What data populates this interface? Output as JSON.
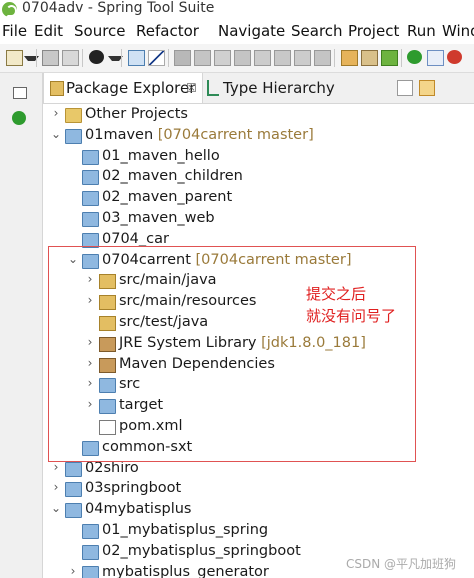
{
  "window": {
    "title": "0704adv - Spring Tool Suite"
  },
  "menu": [
    "File",
    "Edit",
    "Source",
    "Refactor",
    "Navigate",
    "Search",
    "Project",
    "Run",
    "Wind"
  ],
  "tabs": {
    "package_explorer": "Package Explorer",
    "close_glyph": "☒",
    "type_hierarchy": "Type Hierarchy"
  },
  "tree": [
    {
      "label": "Other Projects",
      "branch": "",
      "twisty": "›",
      "icon": "workingset",
      "indent": 0
    },
    {
      "label": "01maven",
      "branch": " [0704carrent master]",
      "twisty": "⌄",
      "icon": "project",
      "indent": 0
    },
    {
      "label": "01_maven_hello",
      "branch": "",
      "twisty": "",
      "icon": "folder",
      "indent": 1
    },
    {
      "label": "02_maven_children",
      "branch": "",
      "twisty": "",
      "icon": "folder",
      "indent": 1
    },
    {
      "label": "02_maven_parent",
      "branch": "",
      "twisty": "",
      "icon": "folder",
      "indent": 1
    },
    {
      "label": "03_maven_web",
      "branch": "",
      "twisty": "",
      "icon": "folder",
      "indent": 1
    },
    {
      "label": "0704_car",
      "branch": "",
      "twisty": "",
      "icon": "folder",
      "indent": 1
    },
    {
      "label": "0704carrent",
      "branch": " [0704carrent master]",
      "twisty": "⌄",
      "icon": "mavenproject",
      "indent": 1
    },
    {
      "label": "src/main/java",
      "branch": "",
      "twisty": "›",
      "icon": "srcfolder",
      "indent": 2
    },
    {
      "label": "src/main/resources",
      "branch": "",
      "twisty": "›",
      "icon": "srcfolder",
      "indent": 2
    },
    {
      "label": "src/test/java",
      "branch": "",
      "twisty": "",
      "icon": "srcfolder",
      "indent": 2
    },
    {
      "label": "JRE System Library",
      "branch": " [jdk1.8.0_181]",
      "twisty": "›",
      "icon": "library",
      "indent": 2
    },
    {
      "label": "Maven Dependencies",
      "branch": "",
      "twisty": "›",
      "icon": "library",
      "indent": 2
    },
    {
      "label": "src",
      "branch": "",
      "twisty": "›",
      "icon": "folder",
      "indent": 2
    },
    {
      "label": "target",
      "branch": "",
      "twisty": "›",
      "icon": "folder",
      "indent": 2
    },
    {
      "label": "pom.xml",
      "branch": "",
      "twisty": "",
      "icon": "file",
      "indent": 2
    },
    {
      "label": "common-sxt",
      "branch": "",
      "twisty": "",
      "icon": "folder",
      "indent": 1
    },
    {
      "label": "02shiro",
      "branch": "",
      "twisty": "›",
      "icon": "project",
      "indent": 0
    },
    {
      "label": "03springboot",
      "branch": "",
      "twisty": "›",
      "icon": "project",
      "indent": 0
    },
    {
      "label": "04mybatisplus",
      "branch": "",
      "twisty": "⌄",
      "icon": "project",
      "indent": 0
    },
    {
      "label": "01_mybatisplus_spring",
      "branch": "",
      "twisty": "",
      "icon": "folder",
      "indent": 1
    },
    {
      "label": "02_mybatisplus_springboot",
      "branch": "",
      "twisty": "",
      "icon": "folder",
      "indent": 1
    },
    {
      "label": "mybatisplus_generator",
      "branch": "",
      "twisty": "›",
      "icon": "folder",
      "indent": 1
    }
  ],
  "annotation": {
    "line1": "提交之后",
    "line2": "就没有问号了"
  },
  "watermark": "CSDN @平凡加班狗",
  "colors": {
    "annotation": "#e02020",
    "branch_decoration": "#9a7a3a",
    "spring_green": "#6db33f"
  }
}
